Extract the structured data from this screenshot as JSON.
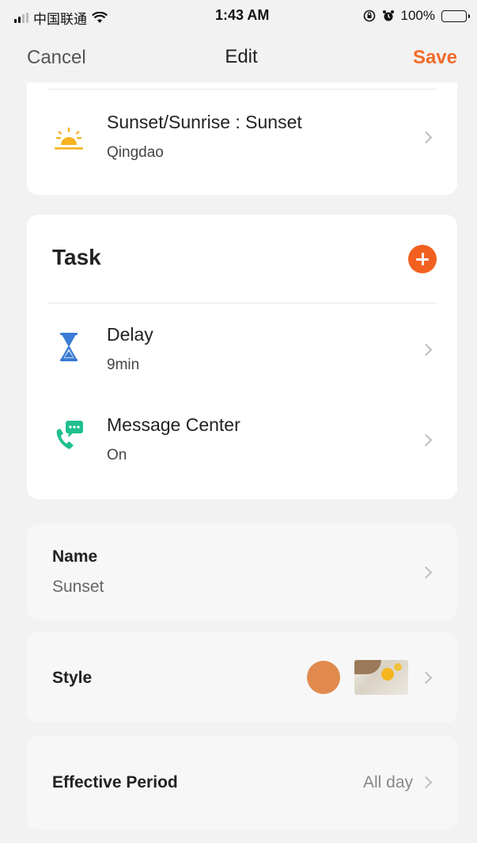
{
  "status_bar": {
    "carrier": "中国联通",
    "time": "1:43 AM",
    "battery": "100%",
    "battery_level": 1.0
  },
  "nav": {
    "cancel": "Cancel",
    "title": "Edit",
    "save": "Save",
    "save_color": "#f26b2b"
  },
  "condition": {
    "title": "Sunset/Sunrise : Sunset",
    "subtitle": "Qingdao",
    "icon": "sunset-icon"
  },
  "task": {
    "title": "Task",
    "add_icon": "add-icon",
    "items": [
      {
        "title": "Delay",
        "subtitle": "9min",
        "icon": "hourglass-icon"
      },
      {
        "title": "Message Center",
        "subtitle": "On",
        "icon": "message-center-icon"
      }
    ]
  },
  "name": {
    "label": "Name",
    "value": "Sunset"
  },
  "style": {
    "label": "Style",
    "color": "#e08a4e"
  },
  "period": {
    "label": "Effective Period",
    "value": "All day"
  }
}
